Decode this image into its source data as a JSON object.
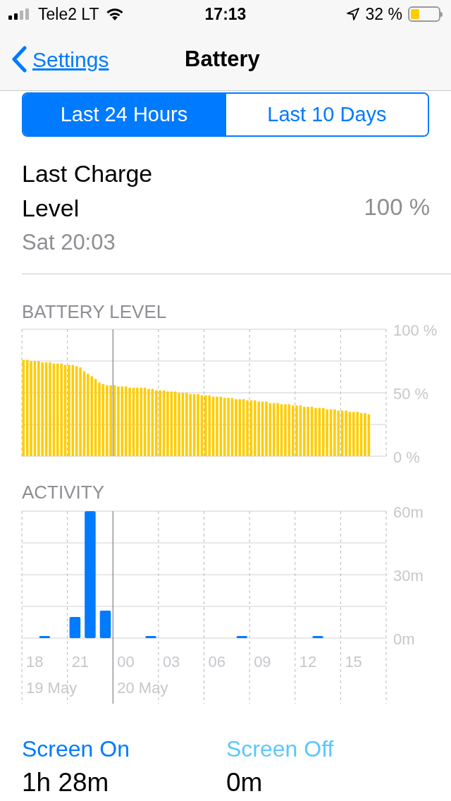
{
  "status_bar": {
    "carrier": "Tele2 LT",
    "time": "17:13",
    "battery_percent": "32 %"
  },
  "nav": {
    "back": "Settings",
    "title": "Battery"
  },
  "segments": [
    {
      "label": "Last 24 Hours",
      "selected": true
    },
    {
      "label": "Last 10 Days",
      "selected": false
    }
  ],
  "last_charge": {
    "label": "Last Charge Level",
    "value": "100 %",
    "time": "Sat 20:03"
  },
  "battery_level": {
    "title": "BATTERY LEVEL",
    "chart_data": {
      "type": "bar",
      "grid": true,
      "ylim": [
        0,
        100
      ],
      "yticks": [
        {
          "value": 0,
          "label": "0 %"
        },
        {
          "value": 50,
          "label": "50 %"
        },
        {
          "value": 100,
          "label": "100 %"
        }
      ],
      "series": [
        {
          "color": "#ffcc00",
          "values": [
            76,
            76,
            75,
            75,
            75,
            74,
            74,
            74,
            73,
            73,
            73,
            72,
            72,
            72,
            71,
            70,
            67,
            65,
            63,
            61,
            58,
            57,
            56,
            56,
            56,
            55,
            55,
            55,
            54,
            54,
            54,
            54,
            54,
            53,
            53,
            52,
            52,
            52,
            51,
            51,
            51,
            50,
            50,
            50,
            49,
            49,
            49,
            48,
            48,
            48,
            47,
            47,
            47,
            46,
            46,
            46,
            45,
            45,
            45,
            44,
            44,
            44,
            43,
            43,
            43,
            42,
            42,
            42,
            41,
            41,
            41,
            40,
            40,
            40,
            39,
            39,
            39,
            38,
            38,
            38,
            37,
            37,
            37,
            36,
            36,
            36,
            35,
            35,
            35,
            34,
            34,
            33
          ]
        }
      ]
    }
  },
  "activity": {
    "title": "ACTIVITY",
    "chart_data": {
      "type": "bar",
      "grid": true,
      "ylim": [
        0,
        60
      ],
      "yticks": [
        {
          "value": 0,
          "label": "0m"
        },
        {
          "value": 30,
          "label": "30m"
        },
        {
          "value": 60,
          "label": "60m"
        }
      ],
      "categories": [
        "18",
        null,
        null,
        "21",
        null,
        null,
        "00",
        null,
        null,
        "03",
        null,
        null,
        "06",
        null,
        null,
        "09",
        null,
        null,
        "12",
        null,
        null,
        "15",
        null,
        null
      ],
      "series": [
        {
          "color": "#007aff",
          "values": [
            0,
            1,
            0,
            10,
            60,
            13,
            0,
            0,
            1,
            0,
            0,
            0,
            0,
            0,
            1,
            0,
            0,
            0,
            0,
            1,
            0,
            0,
            0,
            0
          ]
        }
      ]
    },
    "date_labels": [
      "19 May",
      "20 May"
    ]
  },
  "usage": [
    {
      "label": "Screen On",
      "value": "1h 28m",
      "color": "#007aff"
    },
    {
      "label": "Screen Off",
      "value": "0m",
      "color": "#5ac8fa"
    }
  ]
}
